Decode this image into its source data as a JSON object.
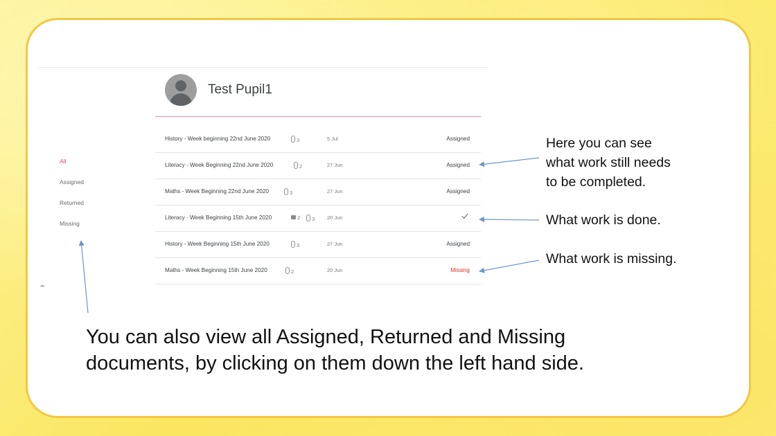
{
  "pupil": {
    "name": "Test Pupil1"
  },
  "sidebar": {
    "items": [
      {
        "label": "All",
        "active": true
      },
      {
        "label": "Assigned",
        "active": false
      },
      {
        "label": "Returned",
        "active": false
      },
      {
        "label": "Missing",
        "active": false
      }
    ],
    "stray_glyph": "⌢"
  },
  "work": {
    "rows": [
      {
        "title": "History - Week beginning 22nd June 2020",
        "attachments": "3",
        "comments": "",
        "date": "5 Jul",
        "status": "Assigned",
        "status_type": "assigned"
      },
      {
        "title": "Literacy - Week Beginning 22nd June 2020",
        "attachments": "2",
        "comments": "",
        "date": "27 Jun",
        "status": "Assigned",
        "status_type": "assigned"
      },
      {
        "title": "Maths - Week Beginning 22nd June 2020",
        "attachments": "3",
        "comments": "",
        "date": "27 Jun",
        "status": "Assigned",
        "status_type": "assigned"
      },
      {
        "title": "Literacy - Week Beginning 15th June 2020",
        "attachments": "3",
        "comments": "2",
        "date": "20 Jun",
        "status": "",
        "status_type": "done"
      },
      {
        "title": "History - Week Beginning 15th June 2020",
        "attachments": "3",
        "comments": "",
        "date": "27 Jun",
        "status": "Assigned",
        "status_type": "assigned"
      },
      {
        "title": "Maths - Week Beginning 15th June 2020",
        "attachments": "2",
        "comments": "",
        "date": "20 Jun",
        "status": "Missing",
        "status_type": "missing"
      }
    ]
  },
  "annotations": {
    "still_needs_line1": "Here you can see",
    "still_needs_line2": "what work still needs",
    "still_needs_line3": "to be completed.",
    "done": "What work is done.",
    "missing": "What work is missing.",
    "bottom_line1": "You can also view all Assigned, Returned and Missing",
    "bottom_line2": "documents, by clicking on them down the left hand side."
  },
  "colors": {
    "accent_pink": "#e0407a",
    "missing_red": "#d93025",
    "card_border": "#f2c744",
    "arrow_blue": "#6c95c8"
  }
}
